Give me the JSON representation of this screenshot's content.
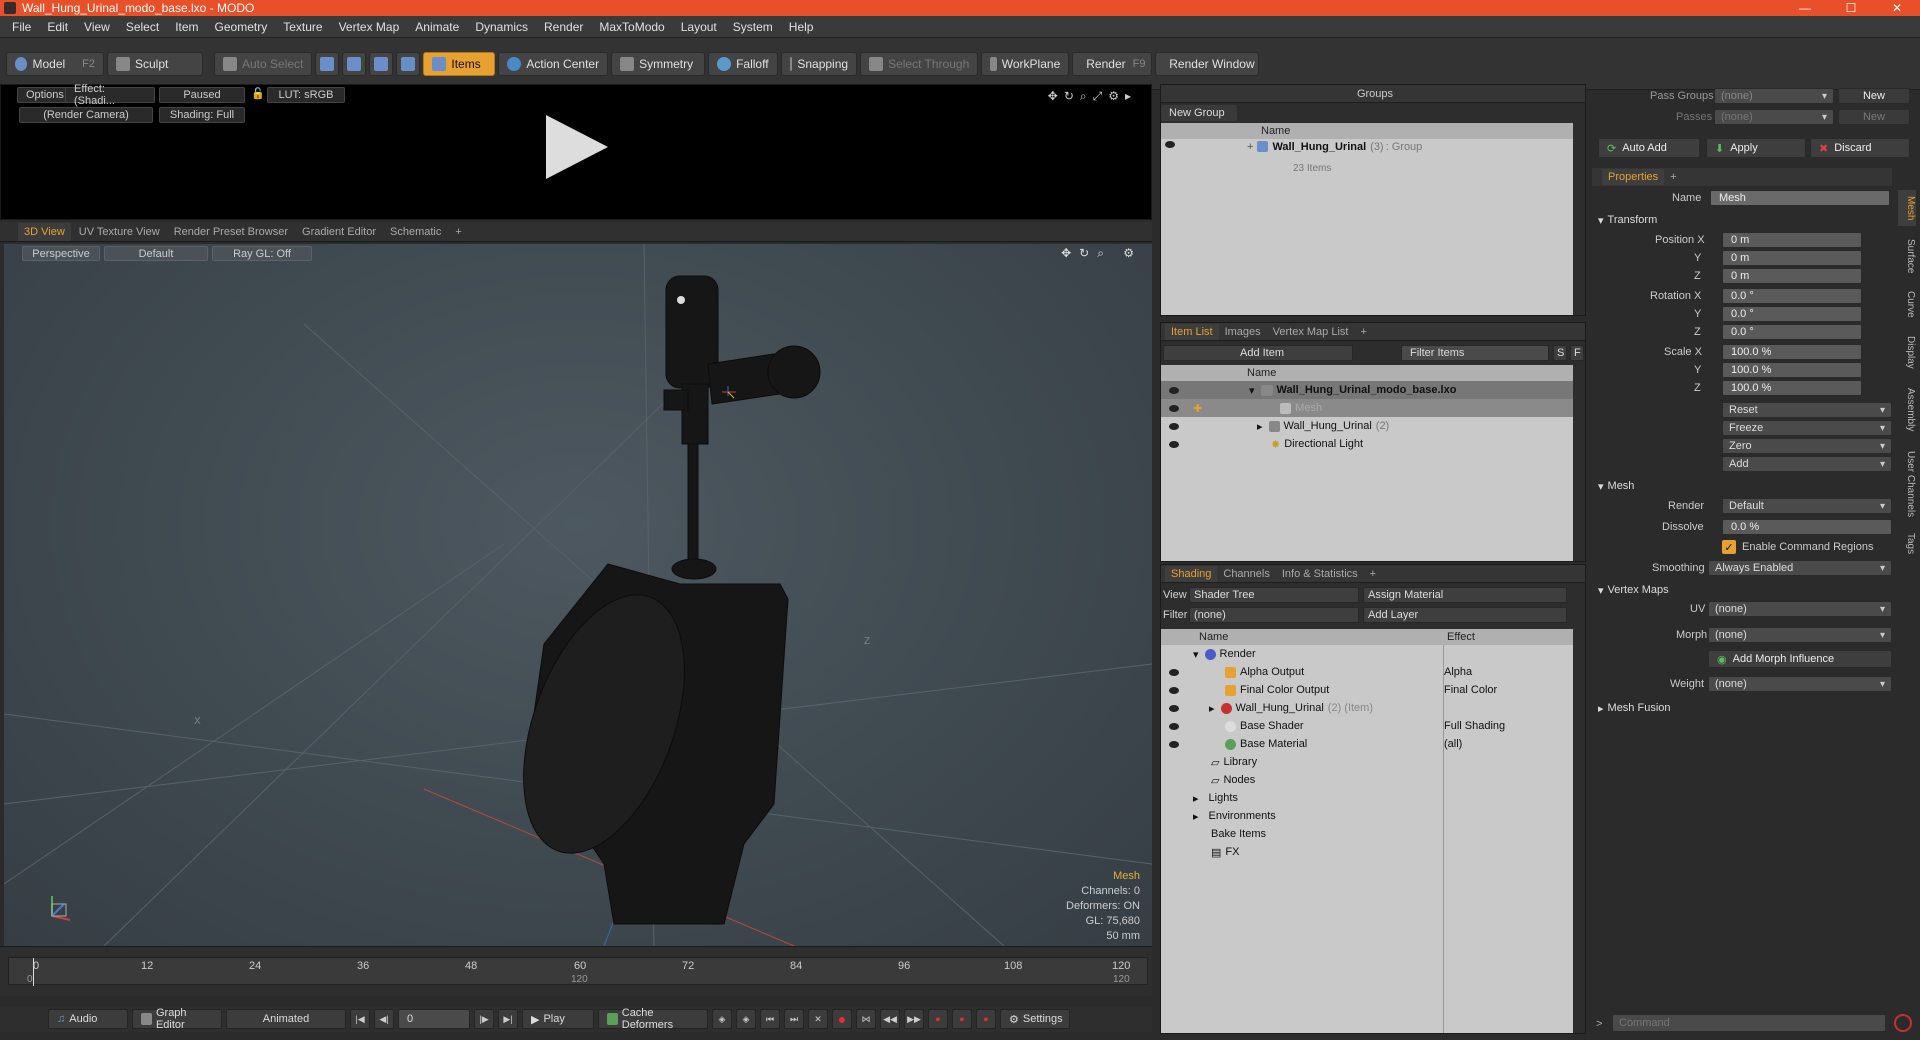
{
  "window": {
    "title": "Wall_Hung_Urinal_modo_base.lxo - MODO"
  },
  "menu": [
    "File",
    "Edit",
    "View",
    "Select",
    "Item",
    "Geometry",
    "Texture",
    "Vertex Map",
    "Animate",
    "Dynamics",
    "Render",
    "MaxToModo",
    "Layout",
    "System",
    "Help"
  ],
  "toolbar": {
    "model": "Model",
    "model_key": "F2",
    "sculpt": "Sculpt",
    "auto_select": "Auto Select",
    "items": "Items",
    "action_center": "Action Center",
    "symmetry": "Symmetry",
    "falloff": "Falloff",
    "snapping": "Snapping",
    "select_through": "Select Through",
    "workplane": "WorkPlane",
    "render": "Render",
    "render_key": "F9",
    "render_window": "Render Window"
  },
  "preview": {
    "options": "Options",
    "effect": "Effect: (Shadi...",
    "paused": "Paused",
    "lut": "LUT: sRGB",
    "camera": "(Render Camera)",
    "shading": "Shading: Full"
  },
  "viewport_tabs": [
    "3D View",
    "UV Texture View",
    "Render Preset Browser",
    "Gradient Editor",
    "Schematic",
    "+"
  ],
  "viewport": {
    "perspective": "Perspective",
    "default": "Default",
    "raygl": "Ray GL: Off",
    "info_title": "Mesh",
    "channels": "Channels: 0",
    "deformers": "Deformers: ON",
    "gl": "GL: 75,680",
    "units": "50 mm",
    "axis_x": "X",
    "axis_z": "Z"
  },
  "timeline": {
    "ticks_top": [
      "0",
      "12",
      "24",
      "36",
      "48",
      "60",
      "72",
      "84",
      "96",
      "108",
      "120"
    ],
    "ticks_bottom": [
      "0",
      "120",
      "120"
    ]
  },
  "transport": {
    "audio": "Audio",
    "graph_editor": "Graph Editor",
    "animated": "Animated",
    "frame": "0",
    "play": "Play",
    "cache": "Cache Deformers",
    "settings": "Settings"
  },
  "groups": {
    "title": "Groups",
    "new_group": "New Group",
    "col_name": "Name",
    "item_name": "Wall_Hung_Urinal",
    "item_count": "(3)",
    "item_type": ": Group",
    "item_sub": "23 Items"
  },
  "itemlist": {
    "tabs": [
      "Item List",
      "Images",
      "Vertex Map List",
      "+"
    ],
    "add_item": "Add Item",
    "filter": "Filter Items",
    "s": "S",
    "f": "F",
    "col_name": "Name",
    "rows": [
      {
        "label": "Wall_Hung_Urinal_modo_base.lxo",
        "extra": ""
      },
      {
        "label": "Mesh",
        "extra": ""
      },
      {
        "label": "Wall_Hung_Urinal",
        "extra": "(2)"
      },
      {
        "label": "Directional Light",
        "extra": ""
      }
    ]
  },
  "shading": {
    "tabs": [
      "Shading",
      "Channels",
      "Info & Statistics",
      "+"
    ],
    "view_label": "View",
    "view_value": "Shader Tree",
    "assign": "Assign Material",
    "filter_label": "Filter",
    "filter_value": "(none)",
    "add_layer": "Add Layer",
    "col_name": "Name",
    "col_effect": "Effect",
    "rows": [
      {
        "label": "Render",
        "extra": "",
        "effect": ""
      },
      {
        "label": "Alpha Output",
        "extra": "",
        "effect": "Alpha"
      },
      {
        "label": "Final Color Output",
        "extra": "",
        "effect": "Final Color"
      },
      {
        "label": "Wall_Hung_Urinal",
        "extra": "(2) (Item)",
        "effect": ""
      },
      {
        "label": "Base Shader",
        "extra": "",
        "effect": "Full Shading"
      },
      {
        "label": "Base Material",
        "extra": "",
        "effect": "(all)"
      },
      {
        "label": "Library",
        "extra": "",
        "effect": ""
      },
      {
        "label": "Nodes",
        "extra": "",
        "effect": ""
      },
      {
        "label": "Lights",
        "extra": "",
        "effect": ""
      },
      {
        "label": "Environments",
        "extra": "",
        "effect": ""
      },
      {
        "label": "Bake Items",
        "extra": "",
        "effect": ""
      },
      {
        "label": "FX",
        "extra": "",
        "effect": ""
      }
    ]
  },
  "right": {
    "pass_groups": "Pass Groups",
    "pass_groups_value": "(none)",
    "new": "New",
    "passes": "Passes",
    "passes_value": "(none)",
    "new2": "New",
    "auto_add": "Auto Add",
    "apply": "Apply",
    "discard": "Discard",
    "properties_tab": "Properties",
    "plus": "+",
    "name_label": "Name",
    "name_value": "Mesh",
    "transform": "Transform",
    "pos_x_label": "Position X",
    "pos_x": "0 m",
    "y_label": "Y",
    "pos_y": "0 m",
    "z_label": "Z",
    "pos_z": "0 m",
    "rot_x_label": "Rotation X",
    "rot_x": "0.0 °",
    "rot_y": "0.0 °",
    "rot_z": "0.0 °",
    "scale_x_label": "Scale X",
    "scale_x": "100.0 %",
    "scale_y": "100.0 %",
    "scale_z": "100.0 %",
    "reset": "Reset",
    "freeze": "Freeze",
    "zero": "Zero",
    "add": "Add",
    "mesh_section": "Mesh",
    "render_label": "Render",
    "render_value": "Default",
    "dissolve_label": "Dissolve",
    "dissolve_value": "0.0 %",
    "enable_cmd": "Enable Command Regions",
    "smoothing_label": "Smoothing",
    "smoothing_value": "Always Enabled",
    "vmaps": "Vertex Maps",
    "uv_label": "UV",
    "uv_value": "(none)",
    "morph_label": "Morph",
    "morph_value": "(none)",
    "add_morph": "Add Morph Influence",
    "weight_label": "Weight",
    "weight_value": "(none)",
    "mesh_fusion": "Mesh Fusion",
    "command_placeholder": "Command",
    "side_tabs": [
      "Mesh",
      "Surface",
      "Curve",
      "Display",
      "Assembly",
      "User Channels",
      "Tags"
    ]
  },
  "colors": {
    "accent": "#e8a030",
    "titlebar": "#e8502a"
  }
}
